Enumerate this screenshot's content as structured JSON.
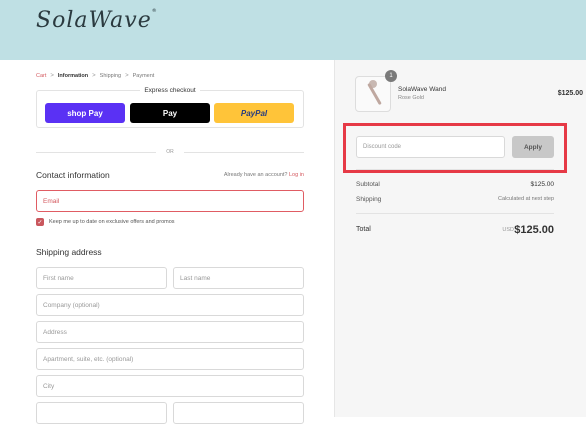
{
  "brand": {
    "logo": "SolaWave",
    "logo_mark": "®"
  },
  "breadcrumb": {
    "cart": "Cart",
    "information": "Information",
    "shipping": "Shipping",
    "payment": "Payment",
    "sep": ">"
  },
  "express": {
    "title": "Express checkout",
    "shop": "shop Pay",
    "apple": " Pay",
    "paypal": "PayPal",
    "or": "OR"
  },
  "contact": {
    "title": "Contact information",
    "have_account": "Already have an account?",
    "login": "Log in",
    "email_placeholder": "Email",
    "newsletter": "Keep me up to date on exclusive offers and promos"
  },
  "shipping": {
    "title": "Shipping address",
    "first_name": "First name",
    "last_name": "Last name",
    "company": "Company (optional)",
    "address": "Address",
    "apartment": "Apartment, suite, etc. (optional)",
    "city": "City"
  },
  "cart": {
    "item_name": "SolaWave Wand",
    "item_variant": "Rose Gold",
    "item_qty": "1",
    "item_price": "$125.00",
    "discount_placeholder": "Discount code",
    "apply": "Apply",
    "subtotal_label": "Subtotal",
    "subtotal_value": "$125.00",
    "shipping_label": "Shipping",
    "shipping_value": "Calculated at next step",
    "total_label": "Total",
    "currency": "USD",
    "total_value": "$125.00"
  },
  "colors": {
    "header_bg": "#bfe0e4",
    "accent": "#d4595f",
    "highlight": "#e63946"
  }
}
